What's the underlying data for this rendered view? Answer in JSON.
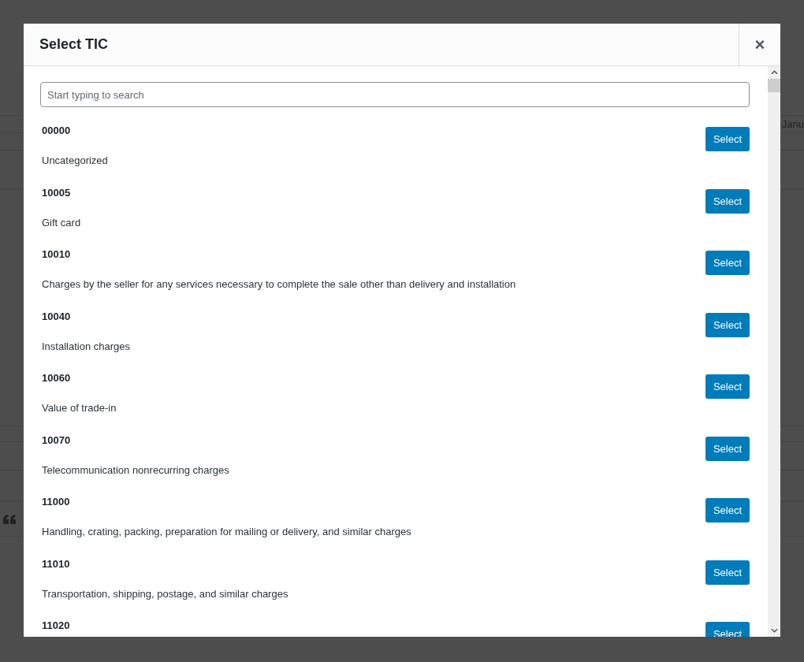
{
  "background": {
    "fragment": "Janu"
  },
  "dialog": {
    "title": "Select TIC",
    "close": "×"
  },
  "search": {
    "placeholder": "Start typing to search"
  },
  "items": [
    {
      "code": "00000",
      "description": "Uncategorized",
      "button": "Select"
    },
    {
      "code": "10005",
      "description": "Gift card",
      "button": "Select"
    },
    {
      "code": "10010",
      "description": "Charges by the seller for any services necessary to complete the sale other than delivery and installation",
      "button": "Select"
    },
    {
      "code": "10040",
      "description": "Installation charges",
      "button": "Select"
    },
    {
      "code": "10060",
      "description": "Value of trade-in",
      "button": "Select"
    },
    {
      "code": "10070",
      "description": "Telecommunication nonrecurring charges",
      "button": "Select"
    },
    {
      "code": "11000",
      "description": "Handling, crating, packing, preparation for mailing or delivery, and similar charges",
      "button": "Select"
    },
    {
      "code": "11010",
      "description": "Transportation, shipping, postage, and similar charges",
      "button": "Select"
    },
    {
      "code": "11020",
      "button": "Select"
    }
  ]
}
